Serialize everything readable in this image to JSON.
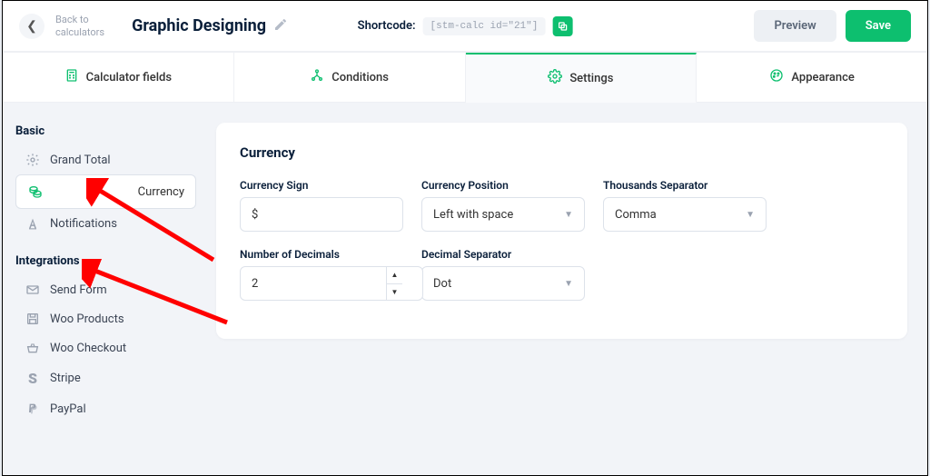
{
  "header": {
    "back_label": "Back to\ncalculators",
    "title": "Graphic Designing",
    "shortcode_label": "Shortcode:",
    "shortcode_value": "[stm-calc id=\"21\"]",
    "preview_label": "Preview",
    "save_label": "Save"
  },
  "tabs": {
    "fields": "Calculator fields",
    "conditions": "Conditions",
    "settings": "Settings",
    "appearance": "Appearance"
  },
  "sidebar": {
    "basic_label": "Basic",
    "integrations_label": "Integrations",
    "basic": {
      "grand_total": "Grand Total",
      "currency": "Currency",
      "notifications": "Notifications"
    },
    "integrations": {
      "send_form": "Send Form",
      "woo_products": "Woo Products",
      "woo_checkout": "Woo Checkout",
      "stripe": "Stripe",
      "paypal": "PayPal"
    }
  },
  "panel": {
    "heading": "Currency",
    "sign_label": "Currency Sign",
    "sign_value": "$",
    "position_label": "Currency Position",
    "position_value": "Left with space",
    "thousands_label": "Thousands Separator",
    "thousands_value": "Comma",
    "decimals_label": "Number of Decimals",
    "decimals_value": "2",
    "decimalsep_label": "Decimal Separator",
    "decimalsep_value": "Dot"
  }
}
